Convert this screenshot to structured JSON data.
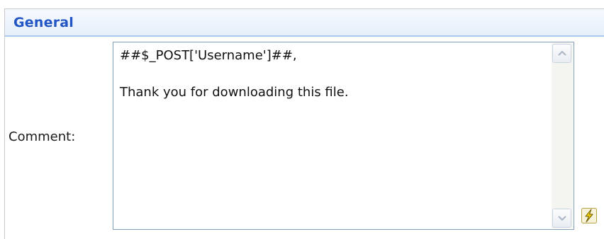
{
  "section": {
    "title": "General"
  },
  "comment_field": {
    "label": "Comment:",
    "value": "##$_POST['Username']##,\n\nThank you for downloading this file."
  },
  "icons": {
    "scroll_up": "chevron-up-icon",
    "scroll_down": "chevron-down-icon",
    "macro": "lightning-bolt-icon"
  },
  "colors": {
    "header_text": "#2256c4",
    "header_border": "#a9c8ee",
    "textarea_border": "#7f9db9",
    "bolt_fill": "#f5d000"
  }
}
